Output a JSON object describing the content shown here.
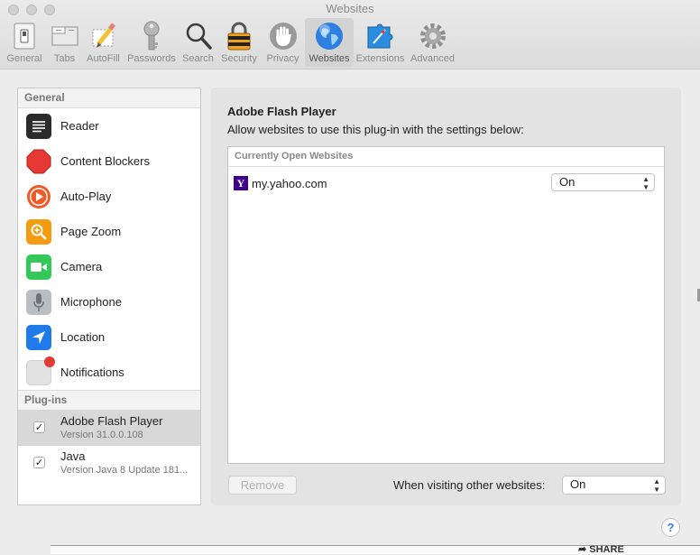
{
  "window": {
    "title": "Websites"
  },
  "toolbar": {
    "tabs": [
      {
        "label": "General",
        "icon": "general-switch-icon"
      },
      {
        "label": "Tabs",
        "icon": "tabs-icon"
      },
      {
        "label": "AutoFill",
        "icon": "autofill-pencil-icon"
      },
      {
        "label": "Passwords",
        "icon": "key-icon"
      },
      {
        "label": "Search",
        "icon": "magnifier-icon"
      },
      {
        "label": "Security",
        "icon": "padlock-icon"
      },
      {
        "label": "Privacy",
        "icon": "hand-icon"
      },
      {
        "label": "Websites",
        "icon": "globe-icon",
        "active": true
      },
      {
        "label": "Extensions",
        "icon": "puzzle-icon"
      },
      {
        "label": "Advanced",
        "icon": "gear-icon"
      }
    ]
  },
  "sidebar": {
    "general_header": "General",
    "items": [
      {
        "label": "Reader",
        "icon": "reader-icon",
        "color": "#2b2b2b"
      },
      {
        "label": "Content Blockers",
        "icon": "stop-sign-icon",
        "color": "#e53935"
      },
      {
        "label": "Auto-Play",
        "icon": "play-icon",
        "color": "#f05a28"
      },
      {
        "label": "Page Zoom",
        "icon": "zoom-icon",
        "color": "#f39c12"
      },
      {
        "label": "Camera",
        "icon": "camera-icon",
        "color": "#34c759"
      },
      {
        "label": "Microphone",
        "icon": "microphone-icon",
        "color": "#9ea3a8"
      },
      {
        "label": "Location",
        "icon": "location-arrow-icon",
        "color": "#1f7aec"
      },
      {
        "label": "Notifications",
        "icon": "notifications-icon",
        "color": "#d8d8d8"
      }
    ],
    "plugins_header": "Plug-ins",
    "plugins": [
      {
        "name": "Adobe Flash Player",
        "version": "Version 31.0.0.108",
        "checked": true,
        "selected": true
      },
      {
        "name": "Java",
        "version": "Version Java 8 Update 181...",
        "checked": true,
        "selected": false
      }
    ]
  },
  "main": {
    "plugin_title": "Adobe Flash Player",
    "description": "Allow websites to use this plug-in with the settings below:",
    "table_header": "Currently Open Websites",
    "sites": [
      {
        "domain": "my.yahoo.com",
        "favicon_letter": "Y",
        "setting": "On"
      }
    ],
    "remove_label": "Remove",
    "other_label": "When visiting other websites:",
    "other_value": "On"
  },
  "help_label": "?",
  "background": {
    "share_label": "SHARE"
  },
  "colors": {
    "accent": "#1f7aec",
    "yahoo": "#400090"
  }
}
